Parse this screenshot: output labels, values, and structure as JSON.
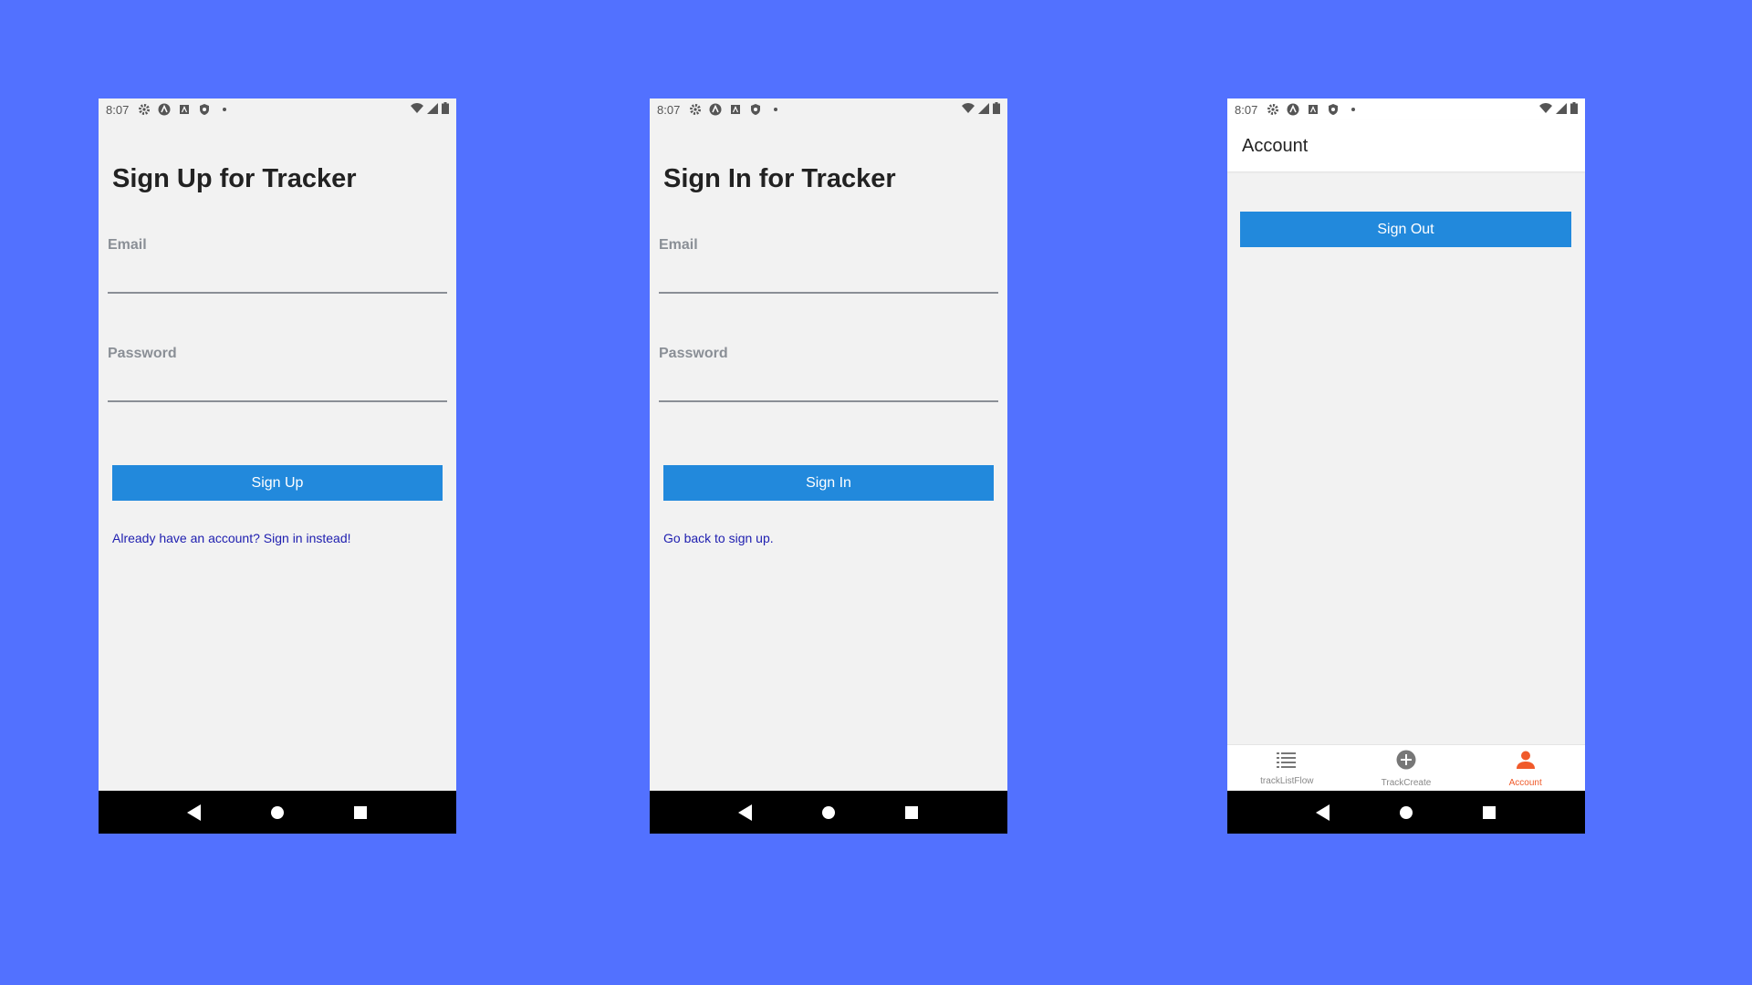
{
  "status_bar": {
    "time": "8:07"
  },
  "signup": {
    "title": "Sign Up for Tracker",
    "email_label": "Email",
    "password_label": "Password",
    "button_label": "Sign Up",
    "link_text": "Already have an account? Sign in instead!"
  },
  "signin": {
    "title": "Sign In for Tracker",
    "email_label": "Email",
    "password_label": "Password",
    "button_label": "Sign In",
    "link_text": "Go back to sign up."
  },
  "account": {
    "header_title": "Account",
    "signout_label": "Sign Out",
    "tabs": [
      {
        "label": "trackListFlow",
        "icon": "list-icon",
        "active": false
      },
      {
        "label": "TrackCreate",
        "icon": "add-circle-icon",
        "active": false
      },
      {
        "label": "Account",
        "icon": "person-icon",
        "active": true
      }
    ]
  },
  "colors": {
    "background": "#5271FF",
    "screen": "#F2F2F2",
    "primary_button": "#2289DC",
    "link": "#2020B0",
    "active_tab": "#F05A2A"
  }
}
